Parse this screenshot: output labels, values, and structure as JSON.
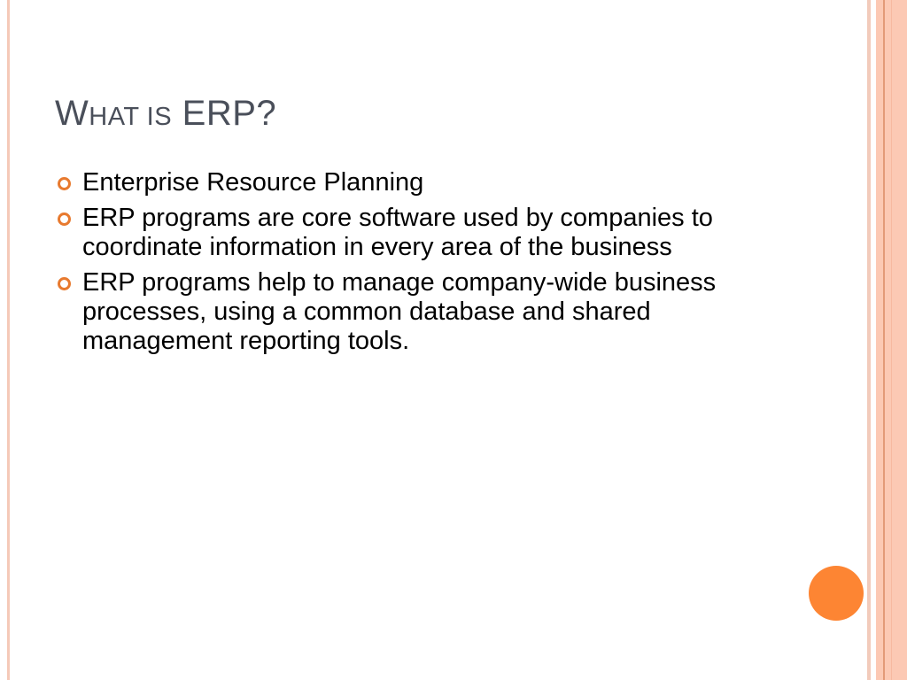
{
  "slide": {
    "title_first": "W",
    "title_smallcaps": "HAT IS",
    "title_rest": "ERP?",
    "bullets": [
      "Enterprise Resource Planning",
      "ERP programs are core software used by companies to coordinate information in every area of the business",
      "ERP programs help to manage company-wide business processes, using a common database and shared management reporting tools."
    ]
  },
  "colors": {
    "accent": "#fd8533",
    "border": "#fcc9b4",
    "title": "#4a4f5a"
  }
}
